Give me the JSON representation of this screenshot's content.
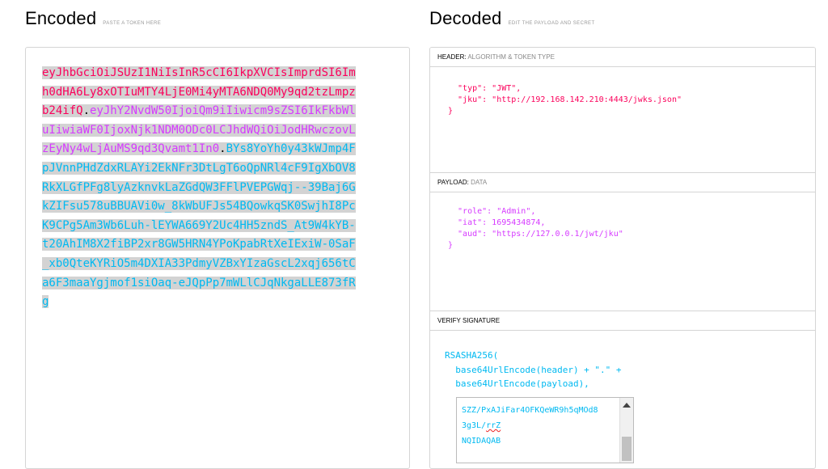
{
  "encoded": {
    "title": "Encoded",
    "subtitle": "PASTE A TOKEN HERE",
    "token": {
      "header": "eyJhbGciOiJSUzI1NiIsInR5cCI6IkpXVCIsImprdSI6Imh0dHA6Ly8xOTIuMTY4LjE0Mi4yMTA6NDQ0My9qd2tzLmpzb24ifQ",
      "dot1": ".",
      "payload": "eyJhY2NvdW50IjoiQm9iIiwicm9sZSI6IkFkbWluIiwiaWF0IjoxNjk1NDM0ODc0LCJhdWQiOiJodHRwczovLzEyNy4wLjAuMS9qd3Qvamt1In0",
      "dot2": ".",
      "signature": "BYs8YoYh0y43kWJmp4FpJVnnPHdZdxRLAYi2EkNFr3DtLgT6oQpNRl4cF9IgXbOV8RkXLGfPFg8lyAzknvkLaZGdQW3FFlPVEPGWqj-​-39Baj6GkZIFsu578uBBUAVi0w_8kWbUFJs54BQowkqSK0SwjhI8PcK9CPg5Am3Wb6Luh-​lEYWA669Y2Uc4HH5zndS_At9W4kYB-​t20AhIM8X2fiBP2xr8GW5HRN4YPoKpabRtXeIExiW-​0SaF_xb0QteKYRiO5m4DXIA33PdmyVZBxYIzaGscL2xqj656tCa6F3maaYgjmof1siOaq-​eJQpPp7mWLlCJqNkgaLLE873fRg"
    }
  },
  "decoded": {
    "title": "Decoded",
    "subtitle": "EDIT THE PAYLOAD AND SECRET",
    "header_label": "HEADER:",
    "header_sublabel": "ALGORITHM & TOKEN TYPE",
    "header_json": "  \"typ\": \"JWT\",\n  \"jku\": \"http://192.168.142.210:4443/jwks.json\"\n}",
    "payload_label": "PAYLOAD:",
    "payload_sublabel": "DATA",
    "payload_json": "  \"role\": \"Admin\",\n  \"iat\": 1695434874,\n  \"aud\": \"https://127.0.0.1/jwt/jku\"\n}",
    "verify_label": "VERIFY SIGNATURE",
    "verify_code": "RSASHA256(\n  base64UrlEncode(header) + \".\" +\n  base64UrlEncode(payload),",
    "pubkey_lines": [
      "SZZ/PxAJiFar4OFKQeWR9h5qMOd8",
      "3g3L/",
      "rrZ",
      "NQIDAQAB"
    ]
  },
  "colors": {
    "header": "#fb015b",
    "payload": "#d63aff",
    "signature": "#00b9f1"
  }
}
